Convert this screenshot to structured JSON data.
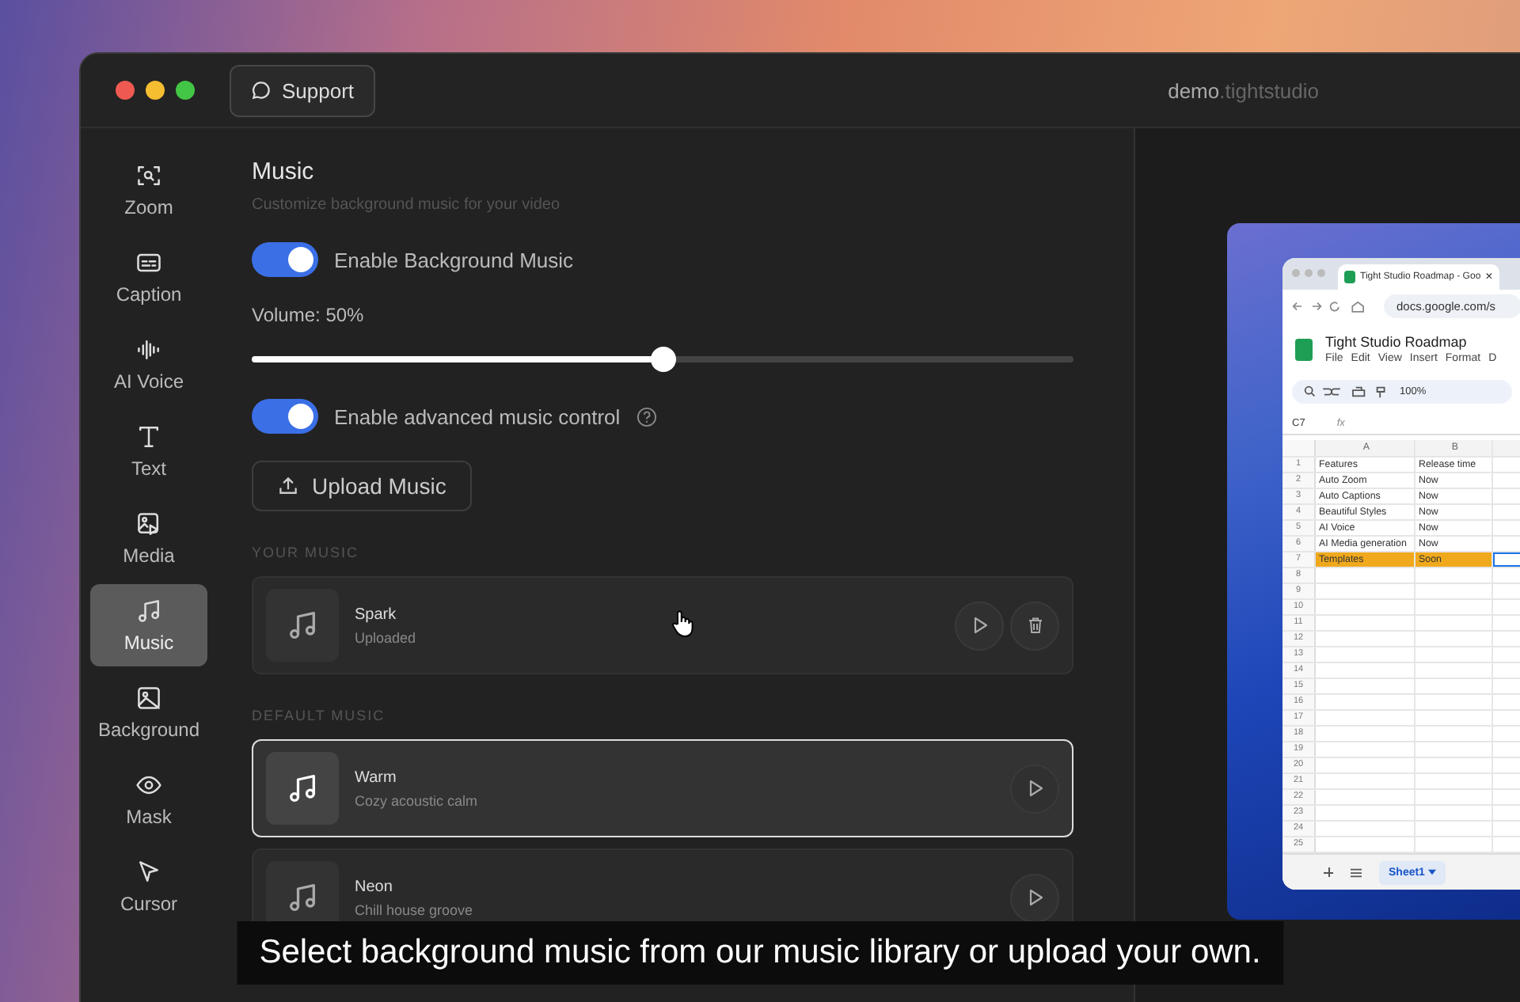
{
  "window": {
    "title_main": "demo",
    "title_rest": ".tightstudio"
  },
  "support_button": {
    "label": "Support"
  },
  "sidebar": {
    "items": [
      {
        "label": "Zoom",
        "selected": false
      },
      {
        "label": "Caption",
        "selected": false
      },
      {
        "label": "AI Voice",
        "selected": false
      },
      {
        "label": "Text",
        "selected": false
      },
      {
        "label": "Media",
        "selected": false
      },
      {
        "label": "Music",
        "selected": true
      },
      {
        "label": "Background",
        "selected": false
      },
      {
        "label": "Mask",
        "selected": false
      },
      {
        "label": "Cursor",
        "selected": false
      }
    ]
  },
  "panel": {
    "title": "Music",
    "subtitle": "Customize background music for your video",
    "controls": [
      {
        "kind": "toggle",
        "label": "Enable Background Music",
        "on": true,
        "help": false
      },
      {
        "kind": "slider",
        "label": "Volume: 50%",
        "level": 0.5
      },
      {
        "kind": "toggle",
        "label": "Enable advanced music control",
        "on": true,
        "help": true
      },
      {
        "kind": "button",
        "label": "Upload Music"
      }
    ],
    "sections": [
      {
        "heading": "YOUR MUSIC",
        "tracks": [
          {
            "kind": "uploaded",
            "title": "Spark",
            "subtitle": "Uploaded",
            "selected": false
          }
        ]
      },
      {
        "heading": "DEFAULT MUSIC",
        "tracks": [
          {
            "kind": "default",
            "title": "Warm",
            "subtitle": "Cozy acoustic calm",
            "selected": true
          },
          {
            "kind": "default",
            "title": "Neon",
            "subtitle": "Chill house groove",
            "selected": false
          }
        ]
      }
    ]
  },
  "preview": {
    "browser": {
      "tab_title": "Tight Studio Roadmap - Goo",
      "tab_close": "×",
      "url": "docs.google.com/s",
      "doc_title": "Tight Studio Roadmap",
      "menus": [
        "File",
        "Edit",
        "View",
        "Insert",
        "Format",
        "D"
      ],
      "zoom": "100%",
      "cell_ref": "C7",
      "formula_label": "fx",
      "columns": [
        "A",
        "B"
      ],
      "rows": [
        {
          "number": "1",
          "cells": [
            "Features",
            "Release time"
          ],
          "highlighted": false
        },
        {
          "number": "2",
          "cells": [
            "Auto Zoom",
            "Now"
          ],
          "highlighted": false
        },
        {
          "number": "3",
          "cells": [
            "Auto Captions",
            "Now"
          ],
          "highlighted": false
        },
        {
          "number": "4",
          "cells": [
            "Beautiful Styles",
            "Now"
          ],
          "highlighted": false
        },
        {
          "number": "5",
          "cells": [
            "AI Voice",
            "Now"
          ],
          "highlighted": false
        },
        {
          "number": "6",
          "cells": [
            "AI Media generation",
            "Now"
          ],
          "highlighted": false
        },
        {
          "number": "7",
          "cells": [
            "Templates",
            "Soon"
          ],
          "highlighted": true
        },
        {
          "number": "8",
          "cells": [],
          "highlighted": false
        },
        {
          "number": "9",
          "cells": [],
          "highlighted": false
        },
        {
          "number": "10",
          "cells": [],
          "highlighted": false
        },
        {
          "number": "11",
          "cells": [],
          "highlighted": false
        },
        {
          "number": "12",
          "cells": [],
          "highlighted": false
        },
        {
          "number": "13",
          "cells": [],
          "highlighted": false
        },
        {
          "number": "14",
          "cells": [],
          "highlighted": false
        },
        {
          "number": "15",
          "cells": [],
          "highlighted": false
        },
        {
          "number": "16",
          "cells": [],
          "highlighted": false
        },
        {
          "number": "17",
          "cells": [],
          "highlighted": false
        },
        {
          "number": "18",
          "cells": [],
          "highlighted": false
        },
        {
          "number": "19",
          "cells": [],
          "highlighted": false
        },
        {
          "number": "20",
          "cells": [],
          "highlighted": false
        },
        {
          "number": "21",
          "cells": [],
          "highlighted": false
        },
        {
          "number": "22",
          "cells": [],
          "highlighted": false
        },
        {
          "number": "23",
          "cells": [],
          "highlighted": false
        },
        {
          "number": "24",
          "cells": [],
          "highlighted": false
        },
        {
          "number": "25",
          "cells": [],
          "highlighted": false
        }
      ],
      "sheet_tab": "Sheet1"
    }
  },
  "caption": "Select background music from our music library or upload your own."
}
